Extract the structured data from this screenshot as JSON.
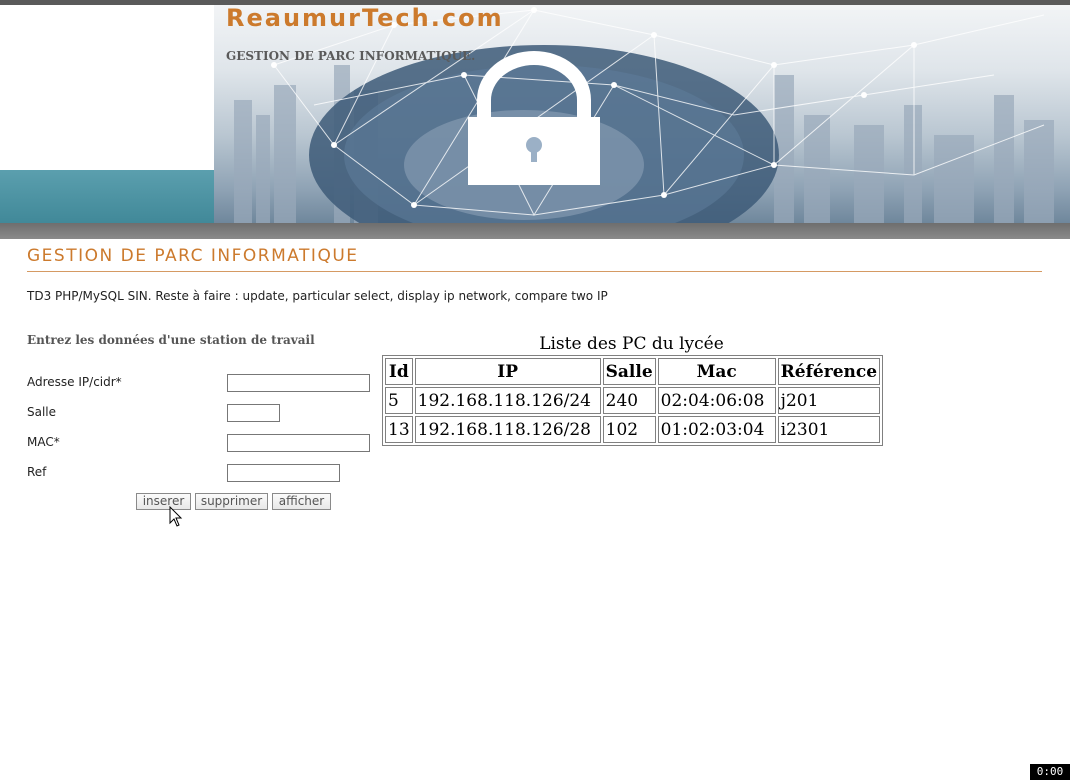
{
  "header": {
    "site_title": "ReaumurTech.com",
    "site_subtitle": "GESTION DE PARC INFORMATIQUE."
  },
  "page": {
    "title": "GESTION DE PARC INFORMATIQUE",
    "description": "TD3 PHP/MySQL SIN. Reste à faire : update, particular select, display ip network, compare two IP"
  },
  "form": {
    "title": "Entrez les données d'une station de travail",
    "fields": {
      "ip_label": "Adresse IP/cidr*",
      "ip_value": "",
      "salle_label": "Salle",
      "salle_value": "",
      "mac_label": "MAC*",
      "mac_value": "",
      "ref_label": "Ref",
      "ref_value": ""
    },
    "buttons": {
      "insert": "inserer",
      "delete": "supprimer",
      "display": "afficher"
    }
  },
  "table": {
    "caption": "Liste des PC du lycée",
    "headers": [
      "Id",
      "IP",
      "Salle",
      "Mac",
      "Référence"
    ],
    "rows": [
      [
        "5",
        "192.168.118.126/24",
        "240",
        "02:04:06:08",
        "j201"
      ],
      [
        "13",
        "192.168.118.126/28",
        "102",
        "01:02:03:04",
        "i2301"
      ]
    ]
  },
  "recorder": {
    "time": "0:00"
  },
  "colors": {
    "accent": "#cc7a2d",
    "teal_band": "#4a91a1",
    "grey_bar": "#7a7a7a"
  }
}
